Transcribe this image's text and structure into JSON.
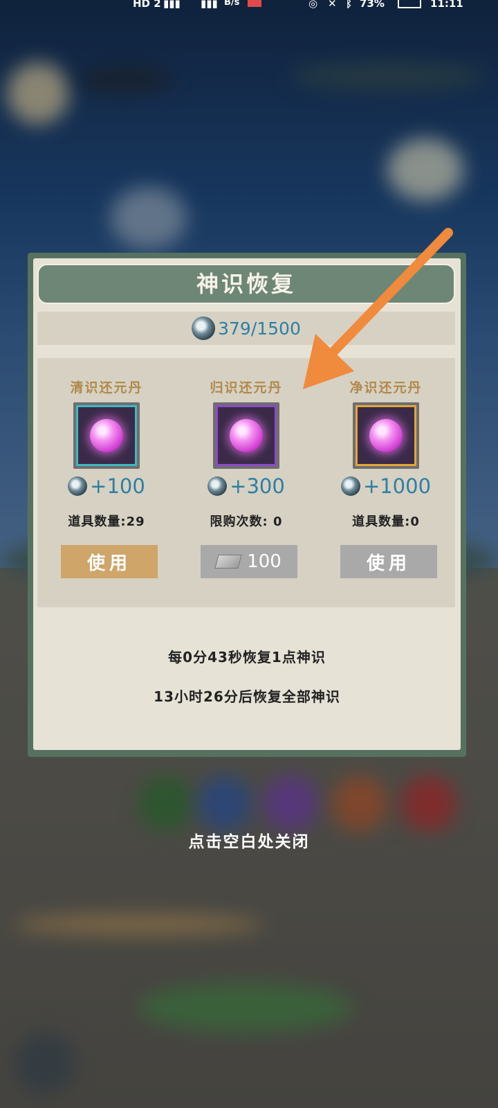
{
  "status_bar": {
    "left_badge": "HD 2",
    "network_speed": "B/s",
    "battery": "73%",
    "time": "11:11"
  },
  "dialog": {
    "title": "神识恢复",
    "energy": "379/1500",
    "items": [
      {
        "name": "清识还元丹",
        "gain": "+100",
        "count_label": "道具数量:29",
        "frame_color": "#3fb8c2",
        "button": {
          "type": "use",
          "label": "使用"
        }
      },
      {
        "name": "归识还元丹",
        "gain": "+300",
        "count_label": "限购次数: 0",
        "frame_color": "#8d4ac7",
        "button": {
          "type": "buy",
          "label": "100",
          "icon": "ticket-icon"
        }
      },
      {
        "name": "净识还元丹",
        "gain": "+1000",
        "count_label": "道具数量:0",
        "frame_color": "#e3a63a",
        "button": {
          "type": "use",
          "label": "使用"
        }
      }
    ],
    "recovery_rate": "每0分43秒恢复1点神识",
    "full_recovery": "13小时26分后恢复全部神识"
  },
  "close_hint": "点击空白处关闭",
  "colors": {
    "dialog_border": "#56715f",
    "accent_value": "#2d7fa3",
    "use_button_active": "#cfa56a",
    "button_disabled": "#a9a9a9",
    "arrow": "#f08a3c"
  }
}
